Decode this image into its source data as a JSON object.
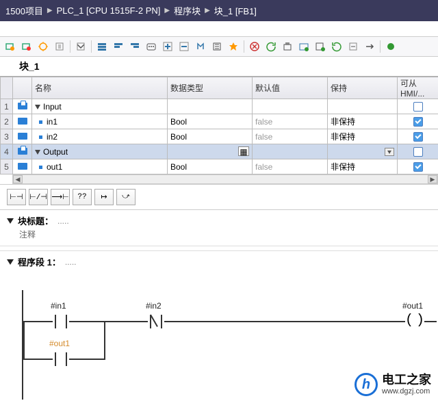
{
  "breadcrumb": {
    "proj": "1500项目",
    "plc": "PLC_1 [CPU 1515F-2 PN]",
    "folder": "程序块",
    "block": "块_1 [FB1]"
  },
  "block_name": "块_1",
  "headers": {
    "name": "名称",
    "dtype": "数据类型",
    "default": "默认值",
    "retain": "保持",
    "hmi": "可从 HMI/..."
  },
  "rows": {
    "r1": {
      "num": "1",
      "name": "Input"
    },
    "r2": {
      "num": "2",
      "name": "in1",
      "dtype": "Bool",
      "def": "false",
      "retain": "非保持"
    },
    "r3": {
      "num": "3",
      "name": "in2",
      "dtype": "Bool",
      "def": "false",
      "retain": "非保持"
    },
    "r4": {
      "num": "4",
      "name": "Output"
    },
    "r5": {
      "num": "5",
      "name": "out1",
      "dtype": "Bool",
      "def": "false",
      "retain": "非保持"
    }
  },
  "ladbtns": {
    "b1": "⊢⊣",
    "b2": "⊢/⊣",
    "b3": "⟶⊢",
    "b4": "??",
    "b5": "↦",
    "b6": "⤻"
  },
  "section": {
    "blocktitle": "块标题：",
    "comment": "注释",
    "network": "程序段 1：",
    "dots": "....."
  },
  "tags": {
    "in1": "#in1",
    "in2": "#in2",
    "out1": "#out1",
    "out1b": "#out1"
  },
  "watermark": {
    "logo": "h",
    "name": "电工之家",
    "url": "www.dgzj.com"
  }
}
